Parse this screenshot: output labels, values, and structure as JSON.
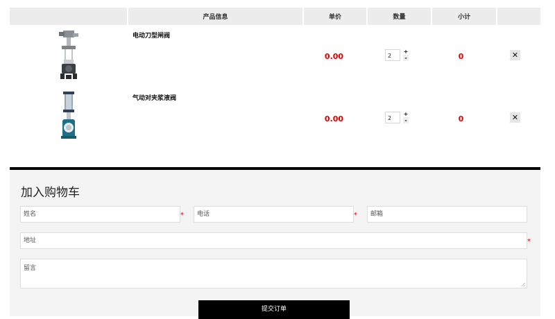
{
  "cart": {
    "headers": {
      "info": "产品信息",
      "price": "单价",
      "qty": "数量",
      "subtotal": "小计"
    },
    "items": [
      {
        "name": "电动刀型闸阀",
        "price": "0.00",
        "qty": "2",
        "subtotal": "0",
        "image_icon": "electric-knife-gate-valve-image"
      },
      {
        "name": "气动对夹浆液阀",
        "price": "0.00",
        "qty": "2",
        "subtotal": "0",
        "image_icon": "pneumatic-slurry-valve-image"
      }
    ],
    "qty_plus": "+",
    "qty_minus": "-",
    "delete_label": "✕"
  },
  "form": {
    "title": "加入购物车",
    "name_placeholder": "姓名",
    "phone_placeholder": "电话",
    "email_placeholder": "邮箱",
    "address_placeholder": "地址",
    "message_placeholder": "留言",
    "required_mark": "*",
    "submit_label": "提交订单"
  },
  "colors": {
    "price": "#e00000",
    "header_bg": "#ececec",
    "form_bg": "#f4f4f4",
    "button_bg": "#000000"
  }
}
